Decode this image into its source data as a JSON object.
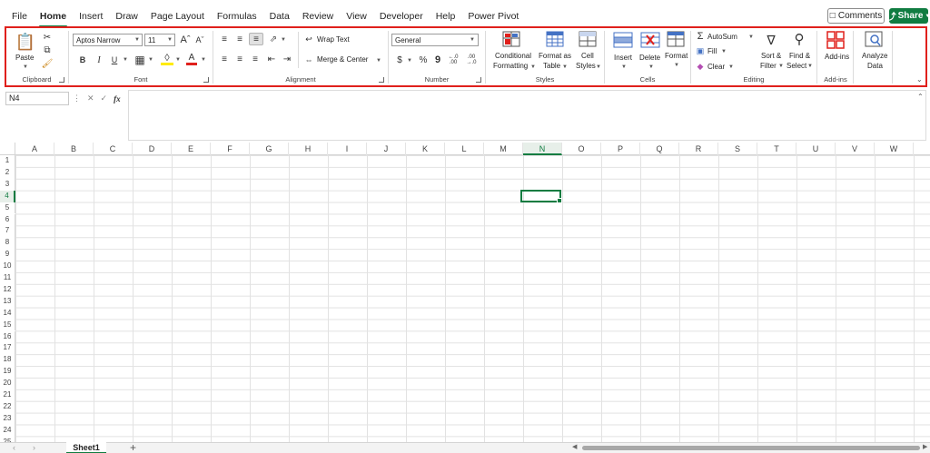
{
  "menu": {
    "tabs": [
      "File",
      "Home",
      "Insert",
      "Draw",
      "Page Layout",
      "Formulas",
      "Data",
      "Review",
      "View",
      "Developer",
      "Help",
      "Power Pivot"
    ],
    "active_tab": "Home",
    "comments_label": "Comments",
    "share_label": "Share"
  },
  "ribbon": {
    "clipboard": {
      "label": "Clipboard",
      "paste_label": "Paste"
    },
    "font": {
      "label": "Font",
      "font_name": "Aptos Narrow",
      "font_size": "11",
      "bold": "B",
      "italic": "I",
      "underline": "U",
      "grow": "A^",
      "shrink": "Av",
      "font_color_glyph": "A"
    },
    "alignment": {
      "label": "Alignment",
      "wrap_text": "Wrap Text",
      "merge_center": "Merge & Center"
    },
    "number": {
      "label": "Number",
      "format": "General",
      "currency": "$",
      "percent": "%",
      "comma": "9",
      "inc_decimal": "←.0 .00",
      "dec_decimal": ".00 →.0"
    },
    "styles": {
      "label": "Styles",
      "conditional_formatting": [
        "Conditional",
        "Formatting"
      ],
      "format_as_table": [
        "Format as",
        "Table"
      ],
      "cell_styles": [
        "Cell",
        "Styles"
      ]
    },
    "cells": {
      "label": "Cells",
      "insert": "Insert",
      "delete": "Delete",
      "format": "Format"
    },
    "editing": {
      "label": "Editing",
      "autosum": "AutoSum",
      "fill": "Fill",
      "clear": "Clear",
      "sort_filter": [
        "Sort &",
        "Filter"
      ],
      "find_select": [
        "Find &",
        "Select"
      ]
    },
    "addins": {
      "label": "Add-ins",
      "addins_button": "Add-ins",
      "analyze_data": [
        "Analyze",
        "Data"
      ]
    }
  },
  "formula_bar": {
    "name_box": "N4",
    "fx": "fx",
    "value": ""
  },
  "grid": {
    "columns": [
      "A",
      "B",
      "C",
      "D",
      "E",
      "F",
      "G",
      "H",
      "I",
      "J",
      "K",
      "L",
      "M",
      "N",
      "O",
      "P",
      "Q",
      "R",
      "S",
      "T",
      "U",
      "V",
      "W"
    ],
    "rows": [
      "1",
      "2",
      "3",
      "4",
      "5",
      "6",
      "7",
      "8",
      "9",
      "10",
      "11",
      "12",
      "13",
      "14",
      "15",
      "16",
      "17",
      "18",
      "19",
      "20",
      "21",
      "22",
      "23",
      "24",
      "25"
    ],
    "selected_column": "N",
    "selected_row": "4"
  },
  "sheets": {
    "tabs": [
      "Sheet1"
    ],
    "add_glyph": "+"
  },
  "colors": {
    "accent": "#107c41",
    "highlight_border": "#e0201c"
  }
}
